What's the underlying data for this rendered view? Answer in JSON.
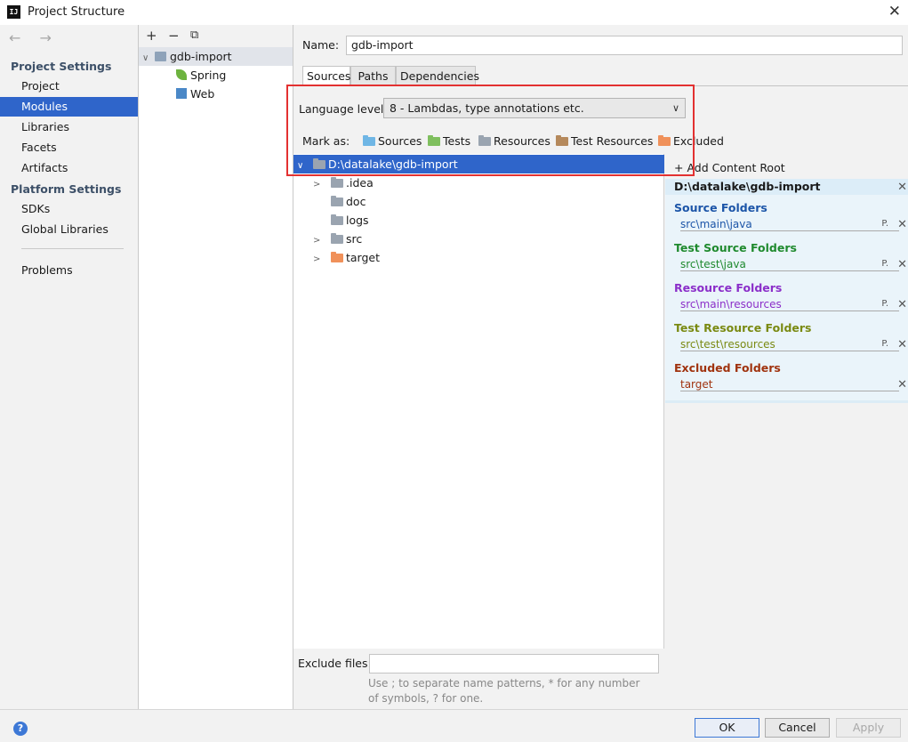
{
  "window": {
    "title": "Project Structure",
    "app_icon": "IJ",
    "close_icon": "✕"
  },
  "nav": {
    "back_forward": "←  →",
    "project_settings": "Project Settings",
    "project_items": [
      "Project",
      "Modules",
      "Libraries",
      "Facets",
      "Artifacts"
    ],
    "platform_settings": "Platform Settings",
    "platform_items": [
      "SDKs",
      "Global Libraries"
    ],
    "problems": "Problems",
    "selected": "Modules"
  },
  "tree_toolbar": {
    "add": "+",
    "remove": "−",
    "copy": "⧉"
  },
  "modules_tree": {
    "module": "gdb-import",
    "children": [
      "Spring",
      "Web"
    ]
  },
  "module": {
    "name_label": "Name:",
    "name": "gdb-import",
    "tabs": [
      "Sources",
      "Paths",
      "Dependencies"
    ],
    "active_tab": "Sources",
    "language_level_label": "Language level:",
    "language_level": "8 - Lambdas, type annotations etc.",
    "mark_as_label": "Mark as:",
    "mark_as": [
      {
        "label": "Sources",
        "color": "#6fb6e5"
      },
      {
        "label": "Tests",
        "color": "#7fbf5e"
      },
      {
        "label": "Resources",
        "color": "#9aa4b0"
      },
      {
        "label": "Test Resources",
        "color": "#b5895c"
      },
      {
        "label": "Excluded",
        "color": "#f0915a"
      }
    ]
  },
  "content_tree": {
    "root": "D:\\datalake\\gdb-import",
    "items": [
      {
        "label": ".idea",
        "expandable": true,
        "color": "#9aa4b0"
      },
      {
        "label": "doc",
        "expandable": false,
        "color": "#9aa4b0"
      },
      {
        "label": "logs",
        "expandable": false,
        "color": "#9aa4b0"
      },
      {
        "label": "src",
        "expandable": true,
        "color": "#9aa4b0"
      },
      {
        "label": "target",
        "expandable": true,
        "color": "#f0915a"
      }
    ]
  },
  "content_roots": {
    "add_label": "Add Content Root",
    "root": "D:\\datalake\\gdb-import",
    "sections": [
      {
        "title": "Source Folders",
        "path": "src\\main\\java",
        "color": "#1c55a8"
      },
      {
        "title": "Test Source Folders",
        "path": "src\\test\\java",
        "color": "#1f8a2e"
      },
      {
        "title": "Resource Folders",
        "path": "src\\main\\resources",
        "color": "#8b2fc9"
      },
      {
        "title": "Test Resource Folders",
        "path": "src\\test\\resources",
        "color": "#7a8a12"
      },
      {
        "title": "Excluded Folders",
        "path": "target",
        "color": "#a0330f"
      }
    ]
  },
  "exclude": {
    "label": "Exclude files:",
    "value": "",
    "hint": "Use ; to separate name patterns, * for any number of symbols, ? for one."
  },
  "buttons": {
    "help": "?",
    "ok": "OK",
    "cancel": "Cancel",
    "apply": "Apply"
  }
}
